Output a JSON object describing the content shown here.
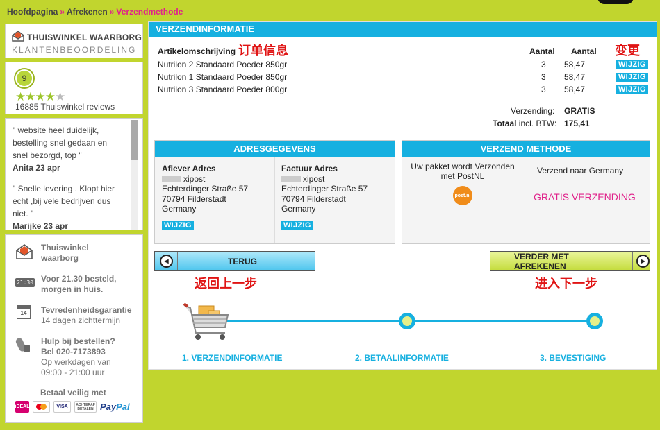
{
  "breadcrumb": {
    "home": "Hoofdpagina",
    "checkout": "Afrekenen",
    "current": "Verzendmethode",
    "sep": "»"
  },
  "sidebar": {
    "thuiswinkel_title": "THUISWINKEL WAARBORG",
    "thuiswinkel_sub": "KLANTENBEOORDELING",
    "score": "9",
    "stars_full": "★★★★",
    "stars_half": "★",
    "review_count": "16885 Thuiswinkel reviews",
    "reviews": [
      {
        "text": "\" website heel duidelijk, bestelling snel gedaan en snel bezorgd, top \"",
        "author": "Anita 23 apr"
      },
      {
        "text": "\" Snelle levering . Klopt hier echt ,bij vele bedrijven dus niet. \"",
        "author": "Marijke 23 apr"
      }
    ],
    "features": [
      {
        "icon": "envelope-icon",
        "line1": "Thuiswinkel",
        "line2": "waarborg"
      },
      {
        "icon": "clock-icon",
        "line1": "Voor 21.30 besteld,",
        "line2": "morgen in huis.",
        "clock": "21:30"
      },
      {
        "icon": "calendar-icon",
        "line1": "Tevredenheidsgarantie",
        "line2": "14 dagen zichttermijn",
        "cal": "14"
      },
      {
        "icon": "phone-icon",
        "line1": "Hulp bij bestellen?",
        "line2": "Bel 020-7173893",
        "line3": "Op werkdagen van",
        "line4": "09:00 - 21:00 uur"
      }
    ],
    "pay_label": "Betaal veilig met",
    "pay_icons": [
      "iDEAL",
      "MC",
      "VISA",
      "ACHTERAF BETALEN"
    ],
    "paypal": [
      "Pay",
      "Pal"
    ]
  },
  "main": {
    "header": "VERZENDINFORMATIE",
    "col_desc": "Artikelomschrijving",
    "col_qty": "Aantal",
    "col_price": "Aantal",
    "ann_order": "订单信息",
    "ann_change": "变更",
    "edit_label": "WIJZIG",
    "rows": [
      {
        "desc": "Nutrilon 2 Standaard Poeder 850gr",
        "qty": "3",
        "price": "58,47"
      },
      {
        "desc": "Nutrilon 1 Standaard Poeder 850gr",
        "qty": "3",
        "price": "58,47"
      },
      {
        "desc": "Nutrilon 3 Standaard Poeder 800gr",
        "qty": "3",
        "price": "58,47"
      }
    ],
    "shipping_label": "Verzending:",
    "shipping_value": "GRATIS",
    "total_label": "Totaal",
    "total_label2": "incl. BTW:",
    "total_value": "175,41",
    "address_header": "ADRESGEGEVENS",
    "delivery": {
      "title": "Aflever Adres",
      "name": "xipost",
      "street": "Echterdinger Straße 57",
      "city": "70794 Filderstadt",
      "country": "Germany"
    },
    "invoice": {
      "title": "Factuur Adres",
      "name": "xipost",
      "street": "Echterdinger Straße 57",
      "city": "70794 Filderstadt",
      "country": "Germany"
    },
    "method_header": "VERZEND METHODE",
    "method_text1": "Uw pakket wordt Verzonden",
    "method_text2": "met PostNL",
    "postnl": "post.nl",
    "method_dest": "Verzend naar Germany",
    "free_shipping": "GRATIS VERZENDING",
    "back_label": "TERUG",
    "back_ann": "返回上一步",
    "next_label": "VERDER MET AFREKENEN",
    "next_ann": "进入下一步",
    "steps": [
      "1. VERZENDINFORMATIE",
      "2. BETAALINFORMATIE",
      "3. BEVESTIGING"
    ]
  }
}
